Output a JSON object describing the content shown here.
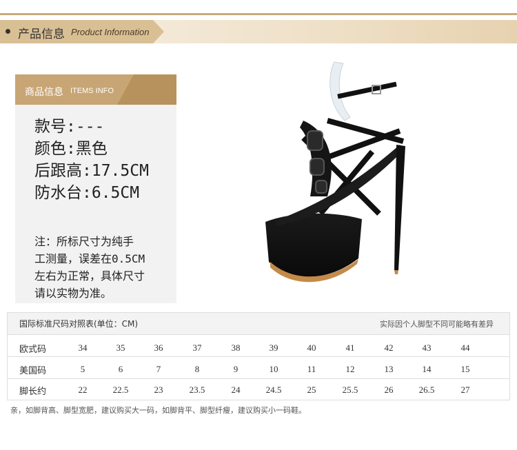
{
  "banner": {
    "title_cn": "产品信息",
    "title_en": "Product Information"
  },
  "items": {
    "head_cn": "商品信息",
    "head_en": "ITEMS INFO",
    "specs": [
      "款号:---",
      "颜色:黑色",
      "后跟高:17.5CM",
      "防水台:6.5CM"
    ],
    "note_lines": [
      "注：所标尺寸为纯手",
      "工测量，误差在0.5CM",
      "左右为正常，具体尺寸",
      "请以实物为准。"
    ]
  },
  "size_chart": {
    "title": "国际标准尺码对照表(单位：CM)",
    "note": "实际因个人脚型不同可能略有差异",
    "rows": [
      {
        "label": "欧式码",
        "values": [
          "34",
          "35",
          "36",
          "37",
          "38",
          "39",
          "40",
          "41",
          "42",
          "43",
          "44"
        ]
      },
      {
        "label": "美国码",
        "values": [
          "5",
          "6",
          "7",
          "8",
          "9",
          "10",
          "11",
          "12",
          "13",
          "14",
          "15"
        ]
      },
      {
        "label": "脚长约",
        "values": [
          "22",
          "22.5",
          "23",
          "23.5",
          "24",
          "24.5",
          "25",
          "25.5",
          "26",
          "26.5",
          "27"
        ]
      }
    ]
  },
  "footnote": "亲，如脚背高、脚型宽肥，建议购买大一码，如脚背平、脚型纤瘦，建议购买小一码鞋。"
}
